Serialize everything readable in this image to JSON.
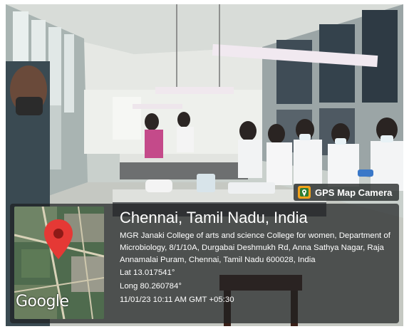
{
  "app_badge": {
    "label": "GPS Map Camera",
    "icon": "map-camera-icon"
  },
  "location": {
    "title": "Chennai, Tamil Nadu, India",
    "address": "MGR Janaki College of arts and science College for women, Department of Microbiology, 8/1/10A, Durgabai Deshmukh Rd, Anna Sathya Nagar, Raja Annamalai Puram, Chennai, Tamil Nadu 600028, India",
    "lat": "Lat 13.017541°",
    "long": "Long 80.260784°",
    "timestamp": "11/01/23 10:11 AM GMT +05:30"
  },
  "map": {
    "brand": "Google",
    "pin_color": "#e53935",
    "icon": "location-pin-icon"
  }
}
